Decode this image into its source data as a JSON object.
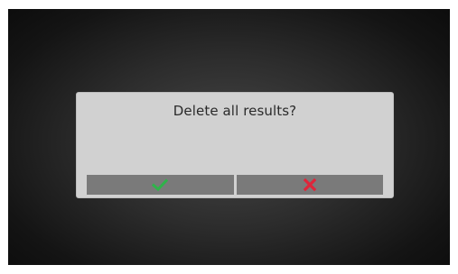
{
  "dialog": {
    "message": "Delete all results?",
    "confirm_icon": "checkmark-icon",
    "cancel_icon": "x-icon"
  },
  "colors": {
    "confirm_icon": "#2fb34a",
    "cancel_icon": "#e0253a",
    "dialog_background": "#d1d1d1",
    "button_background": "#7a7a7a",
    "screen_background": "#1a1a1a"
  }
}
